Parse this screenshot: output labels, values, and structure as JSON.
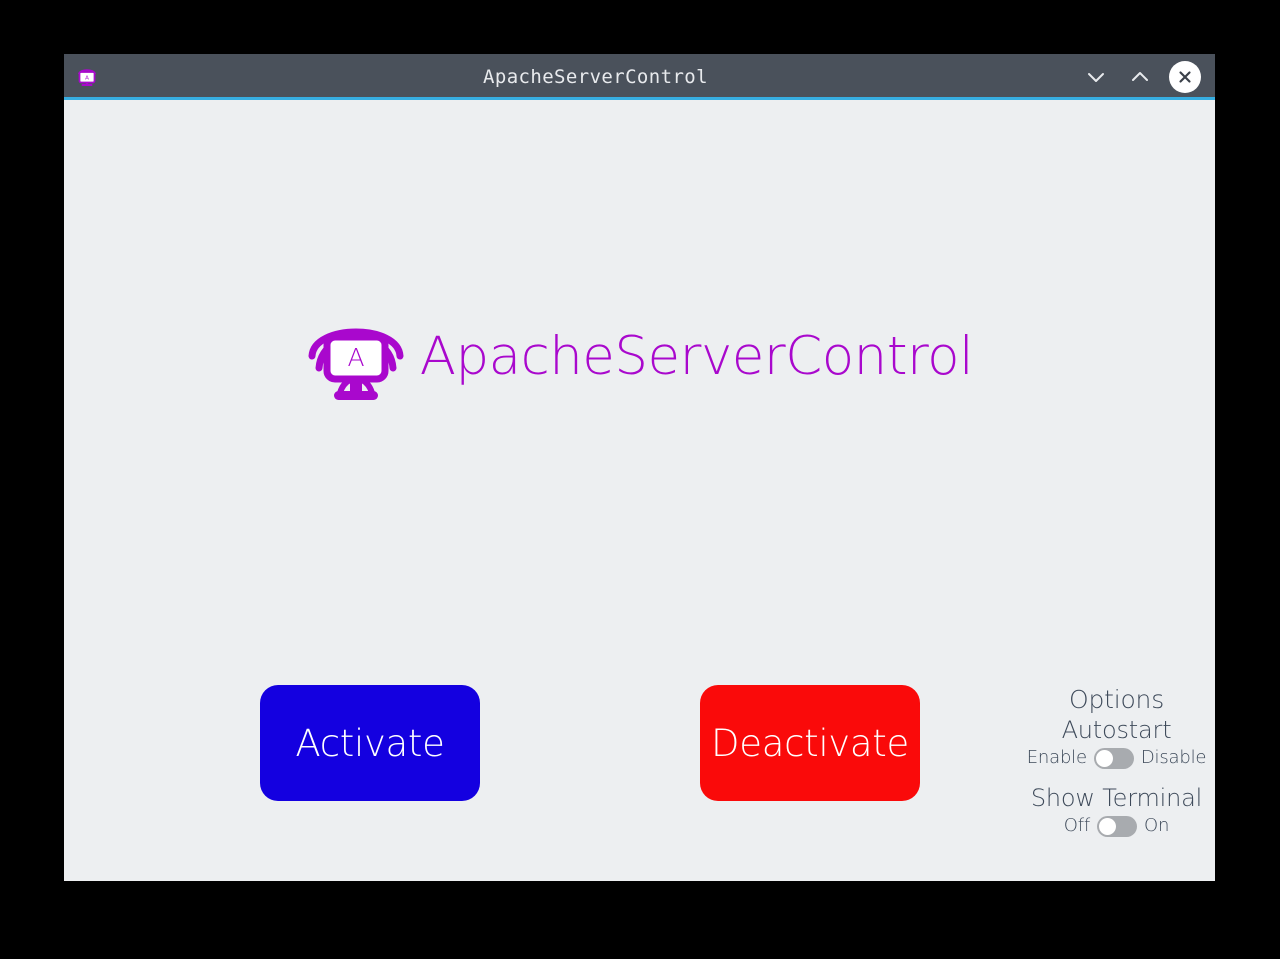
{
  "window": {
    "title": "ApacheServerControl",
    "app_icon": "apache-monitor-icon",
    "controls": {
      "minimize": "chevron-down-icon",
      "maximize": "chevron-up-icon",
      "close": "close-icon"
    }
  },
  "brand": {
    "logo": "apache-server-control-logo",
    "logo_letter": "A",
    "name": "ApacheServerControl",
    "color": "#a908cd"
  },
  "actions": {
    "activate": {
      "label": "Activate",
      "color": "#1400e0"
    },
    "deactivate": {
      "label": "Deactivate",
      "color": "#fa0a0a"
    }
  },
  "options": {
    "heading": "Options",
    "autostart": {
      "label": "Autostart",
      "left_label": "Enable",
      "right_label": "Disable",
      "state": "off"
    },
    "show_terminal": {
      "label": "Show Terminal",
      "left_label": "Off",
      "right_label": "On",
      "state": "off"
    }
  }
}
